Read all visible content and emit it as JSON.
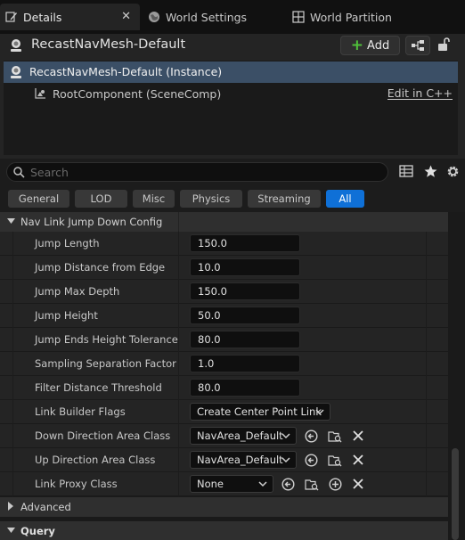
{
  "tabs": [
    {
      "label": "Details",
      "active": true,
      "icon": "pencil-icon"
    },
    {
      "label": "World Settings",
      "active": false,
      "icon": "globe-icon"
    },
    {
      "label": "World Partition",
      "active": false,
      "icon": "grid-icon"
    }
  ],
  "header": {
    "actor_title": "RecastNavMesh-Default",
    "add_label": "Add"
  },
  "tree": {
    "instance_label": "RecastNavMesh-Default (Instance)",
    "root_label": "RootComponent (SceneComp)",
    "edit_link": "Edit in C++"
  },
  "search": {
    "placeholder": "Search"
  },
  "filters": [
    "General",
    "LOD",
    "Misc",
    "Physics",
    "Streaming",
    "All"
  ],
  "active_filter": "All",
  "details": {
    "category_nav_link": "Nav Link Jump Down Config",
    "properties": [
      {
        "name": "Jump Length",
        "value": "150.0"
      },
      {
        "name": "Jump Distance from Edge",
        "value": "10.0"
      },
      {
        "name": "Jump Max Depth",
        "value": "150.0"
      },
      {
        "name": "Jump Height",
        "value": "50.0"
      },
      {
        "name": "Jump Ends Height Tolerance",
        "value": "80.0"
      },
      {
        "name": "Sampling Separation Factor",
        "value": "1.0"
      },
      {
        "name": "Filter Distance Threshold",
        "value": "80.0"
      },
      {
        "name": "Link Builder Flags",
        "value": "Create Center Point Link"
      },
      {
        "name": "Down Direction Area Class",
        "value": "NavArea_Default"
      },
      {
        "name": "Up Direction Area Class",
        "value": "NavArea_Default"
      },
      {
        "name": "Link Proxy Class",
        "value": "None"
      }
    ],
    "category_advanced": "Advanced",
    "category_query": "Query"
  },
  "colors": {
    "accent": "#0f70d7",
    "selection": "#3b4f66",
    "add_plus": "#4fbf3a"
  }
}
